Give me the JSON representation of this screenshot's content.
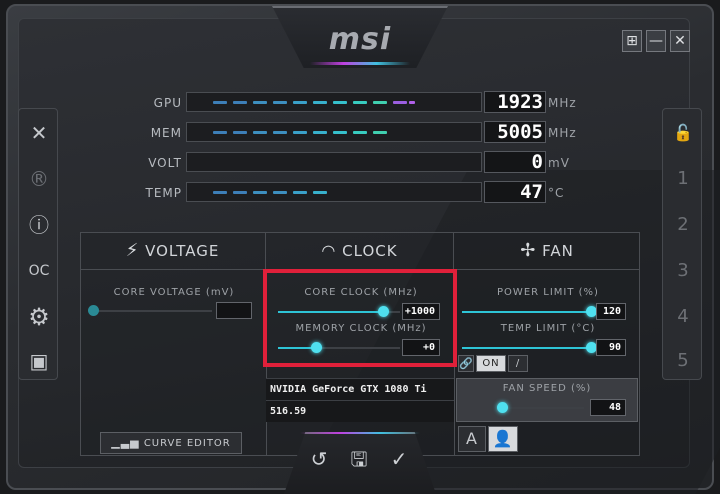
{
  "app": {
    "logo": "msi"
  },
  "window": {
    "controls": [
      "⊞",
      "—",
      "✕"
    ]
  },
  "sidebar_left": {
    "items": [
      {
        "name": "kombustor-icon",
        "glyph": "✕"
      },
      {
        "name": "registered-icon",
        "glyph": "®"
      },
      {
        "name": "info-icon",
        "glyph": "ⓘ"
      },
      {
        "name": "oc-scanner-icon",
        "glyph": "OC"
      },
      {
        "name": "settings-gear-icon",
        "glyph": "⚙"
      },
      {
        "name": "monitor-icon",
        "glyph": "▣"
      }
    ]
  },
  "sidebar_right": {
    "lock": "🔓",
    "profiles": [
      "1",
      "2",
      "3",
      "4",
      "5"
    ]
  },
  "monitor": {
    "rows": [
      {
        "label": "GPU",
        "value": "1923",
        "unit": "MHz"
      },
      {
        "label": "MEM",
        "value": "5005",
        "unit": "MHz"
      },
      {
        "label": "VOLT",
        "value": "0",
        "unit": "mV"
      },
      {
        "label": "TEMP",
        "value": "47",
        "unit": "°C"
      }
    ]
  },
  "tabs": {
    "voltage": "VOLTAGE",
    "clock": "CLOCK",
    "fan": "FAN"
  },
  "voltage": {
    "core_voltage_label": "CORE VOLTAGE (mV)",
    "core_voltage_value": "",
    "core_voltage_level": 0
  },
  "clock": {
    "core_clock_label": "CORE CLOCK (MHz)",
    "core_clock_value": "+1000",
    "core_clock_level": 0.85,
    "memory_clock_label": "MEMORY CLOCK (MHz)",
    "memory_clock_value": "+0",
    "memory_clock_level": 0.3
  },
  "fan": {
    "power_limit_label": "POWER LIMIT (%)",
    "power_limit_value": "120",
    "power_limit_level": 1.0,
    "temp_limit_label": "TEMP LIMIT (°C)",
    "temp_limit_value": "90",
    "temp_limit_level": 1.0,
    "link_toggle": "ON",
    "fan_speed_label": "FAN SPEED (%)",
    "fan_speed_value": "48",
    "fan_speed_level": 0.0
  },
  "gpu_info": {
    "name": "NVIDIA GeForce GTX 1080 Ti",
    "driver": "516.59"
  },
  "buttons": {
    "curve_editor": "CURVE EDITOR",
    "auto": "A"
  },
  "colors": {
    "accent": "#2ec4d6",
    "highlight": "#e0203a"
  }
}
